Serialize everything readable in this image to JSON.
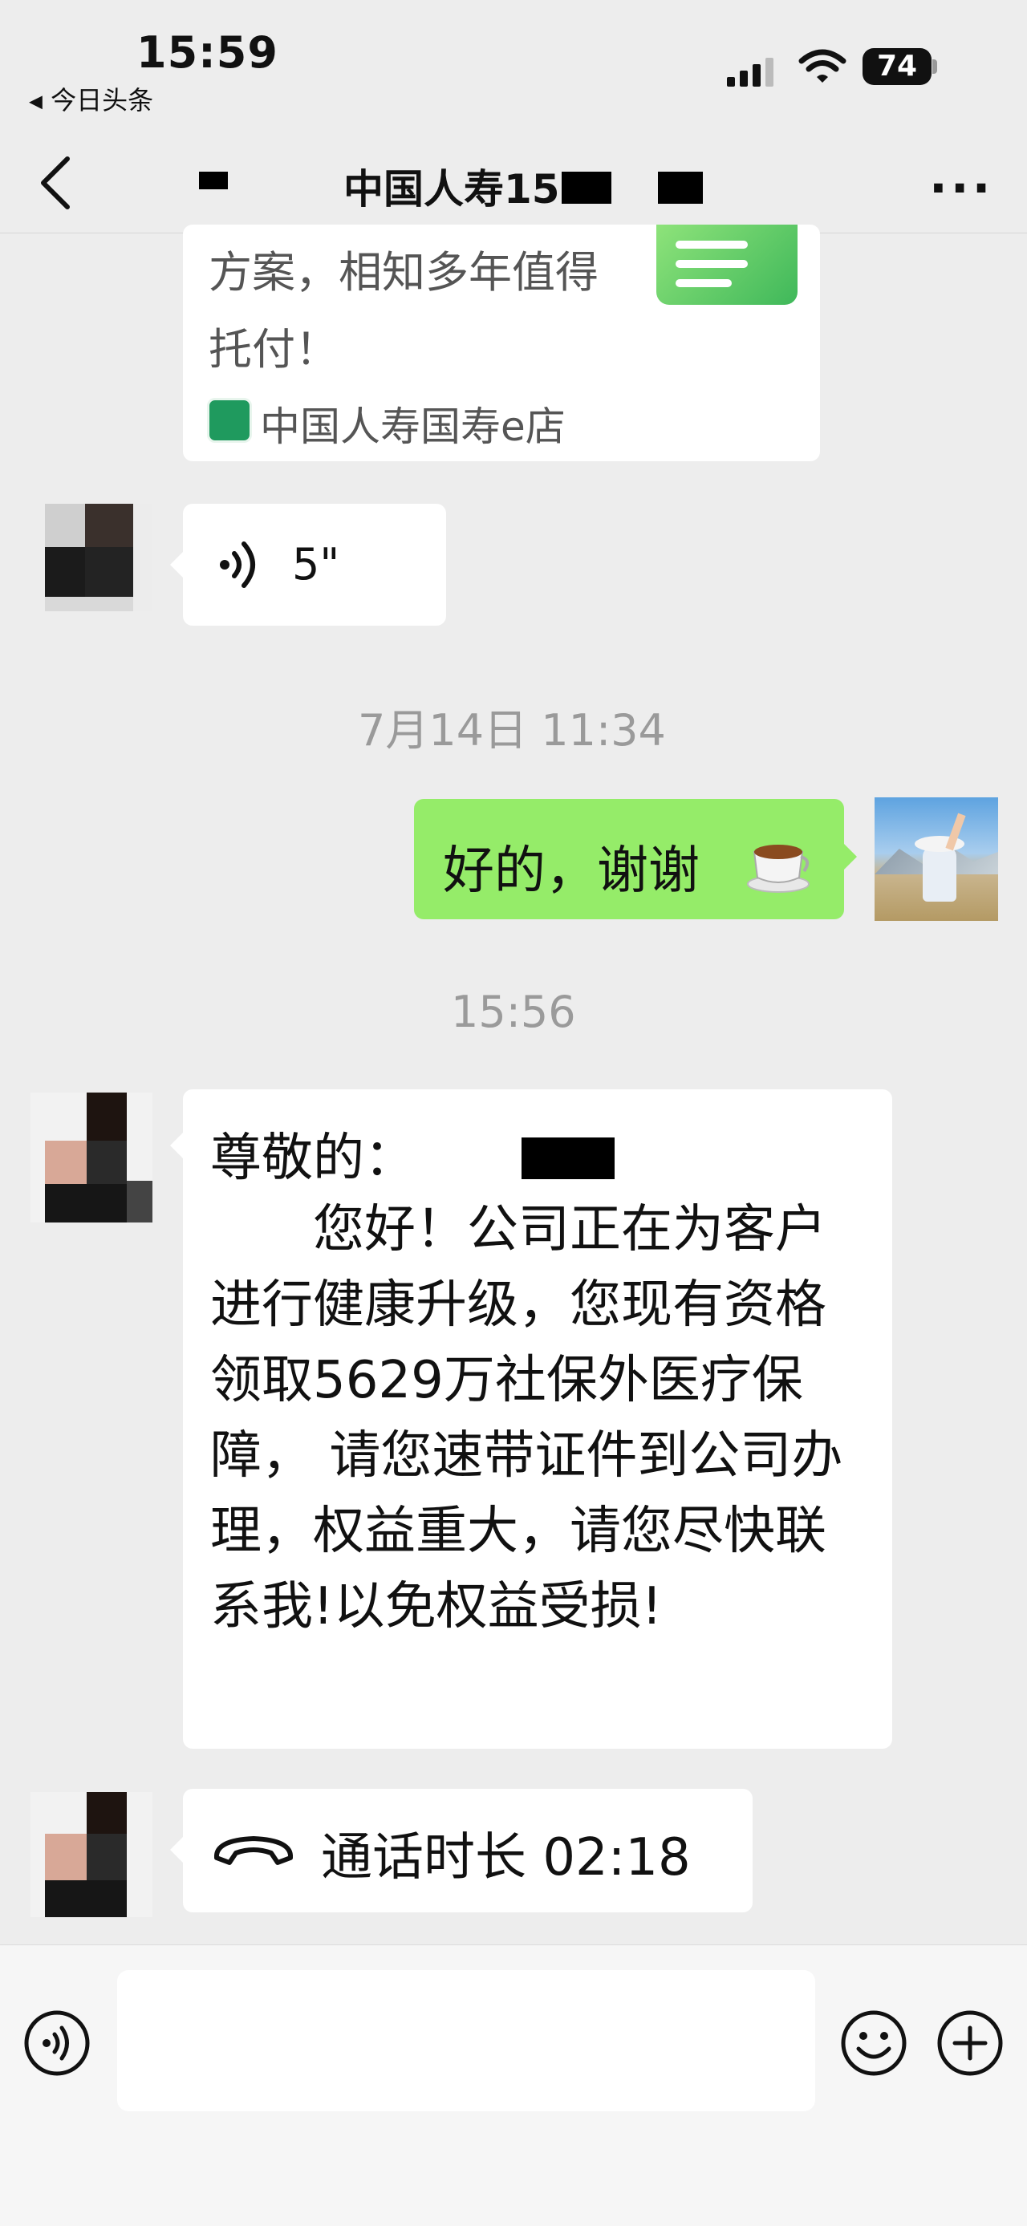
{
  "status_bar": {
    "time": "15:59",
    "back_app": "今日头条",
    "battery": "74"
  },
  "nav": {
    "title": "中国人寿15"
  },
  "link_card": {
    "description": "方案，相知多年值得托付！",
    "source": "中国人寿国寿e店"
  },
  "messages": {
    "voice_duration": "5\"",
    "timestamp_1": "7月14日 11:34",
    "my_reply": "好的，谢谢",
    "timestamp_2": "15:56",
    "notice_greeting": "尊敬的：",
    "notice_body": "　　您好！公司正在为客户进行健康升级，您现有资格领取5629万社保外医疗保障， 请您速带证件到公司办理，权益重大，请您尽快联系我!以免权益受损!",
    "call_label": "通话时长 02:18"
  },
  "icons": {
    "back": "chevron-left-icon",
    "more": "more-dots-icon",
    "voice": "voice-wave-icon",
    "phone": "phone-hangup-icon",
    "emoji": "smiley-icon",
    "add": "plus-circle-icon",
    "coffee": "coffee-emoji"
  },
  "colors": {
    "background": "#ededed",
    "my_bubble": "#95ec69",
    "other_bubble": "#ffffff"
  }
}
